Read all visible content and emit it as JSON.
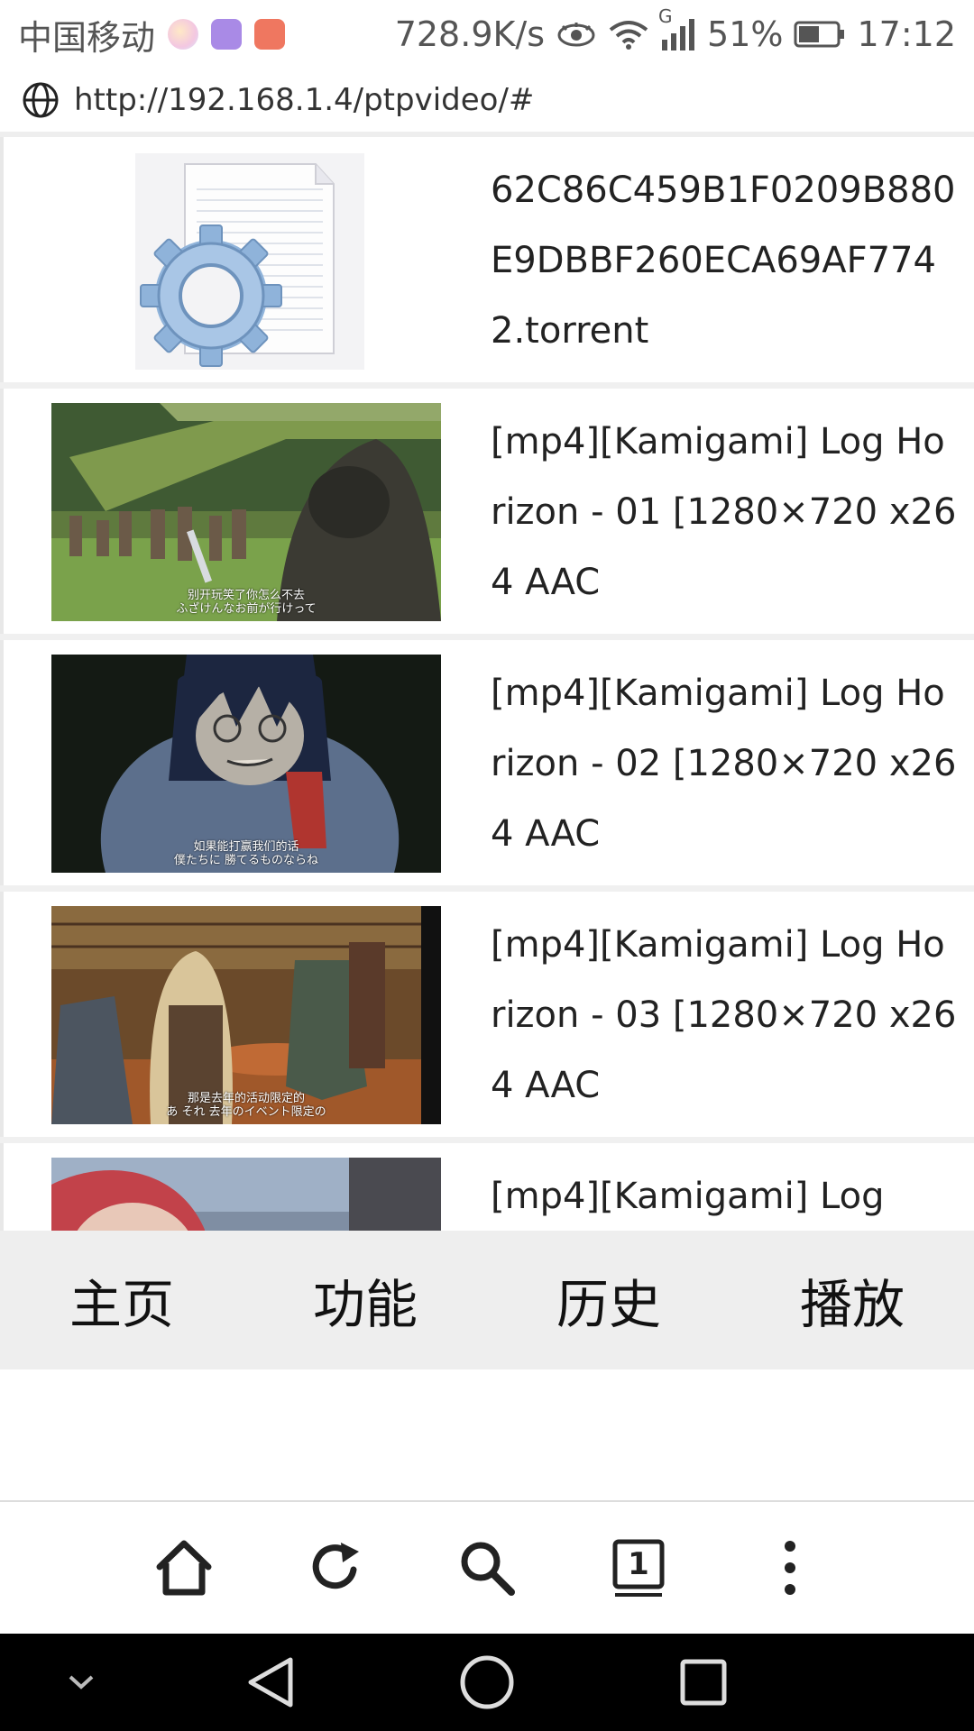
{
  "status_bar": {
    "carrier": "中国移动",
    "speed": "728.9K/s",
    "network_type": "G",
    "battery": "51%",
    "time": "17:12"
  },
  "browser": {
    "url": "http://192.168.1.4/ptpvideo/#"
  },
  "items": [
    {
      "title": "62C86C459B1F0209B880E9DBBF260ECA69AF7742.torrent",
      "kind": "file"
    },
    {
      "title": "[mp4][Kamigami] Log Horizon - 01 [1280×720 x264 AAC",
      "kind": "video",
      "subtitle_cn": "别开玩笑了你怎么不去",
      "subtitle_jp": "ふざけんなお前が行けって"
    },
    {
      "title": "[mp4][Kamigami] Log Horizon - 02 [1280×720 x264 AAC",
      "kind": "video",
      "subtitle_cn": "如果能打赢我们的话",
      "subtitle_jp": "僕たちに 勝てるものならね"
    },
    {
      "title": "[mp4][Kamigami] Log Horizon - 03 [1280×720 x264 AAC",
      "kind": "video",
      "subtitle_cn": "那是去年的活动限定的",
      "subtitle_jp": "あ それ 去年のイベント限定の"
    },
    {
      "title": "[mp4][Kamigami] Log",
      "kind": "video"
    }
  ],
  "tabs": [
    {
      "label": "主页"
    },
    {
      "label": "功能"
    },
    {
      "label": "历史"
    },
    {
      "label": "播放"
    }
  ],
  "toolbar": {
    "tab_count": "1"
  },
  "icons": {
    "globe": "globe-icon",
    "home": "home-icon",
    "refresh": "refresh-icon",
    "search": "search-icon",
    "tabs": "tabs-icon",
    "menu": "more-vertical-icon"
  },
  "colors": {
    "tab_bar_bg": "#eeeeee",
    "nav_bar_bg": "#000000"
  }
}
